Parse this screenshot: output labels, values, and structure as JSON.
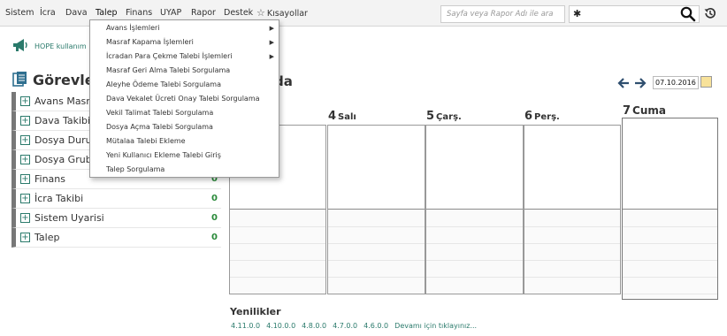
{
  "menubar": {
    "items": [
      "Sistem",
      "İcra",
      "Dava",
      "Talep",
      "Finans",
      "UYAP",
      "Rapor",
      "Destek"
    ],
    "favorites_label": "Kısayollar",
    "search_placeholder": "Sayfa veya Rapor Adı ile ara"
  },
  "dropdown": {
    "items": [
      {
        "label": "Avans İşlemleri",
        "submenu": true
      },
      {
        "label": "Masraf Kapama İşlemleri",
        "submenu": true
      },
      {
        "label": "İcradan Para Çekme Talebi İşlemleri",
        "submenu": true
      },
      {
        "label": "Masraf Geri Alma Talebi Sorgulama",
        "submenu": false
      },
      {
        "label": "Aleyhe Ödeme Talebi Sorgulama",
        "submenu": false
      },
      {
        "label": "Dava Vekalet Ücreti Onay Talebi Sorgulama",
        "submenu": false
      },
      {
        "label": "Vekil Talimat Talebi Sorgulama",
        "submenu": false
      },
      {
        "label": "Dosya Açma Talebi Sorgulama",
        "submenu": false
      },
      {
        "label": "Mütalaa Talebi Ekleme",
        "submenu": false
      },
      {
        "label": "Yeni Kullanıcı Ekleme Talebi Giriş",
        "submenu": false
      },
      {
        "label": "Talep Sorgulama",
        "submenu": false
      }
    ]
  },
  "announcement": "HOPE kullanım",
  "tasks": {
    "title": "Görevler",
    "items": [
      {
        "label": "Avans Masraf",
        "count": ""
      },
      {
        "label": "Dava Takibi",
        "count": ""
      },
      {
        "label": "Dosya Durum",
        "count": ""
      },
      {
        "label": "Dosya Grubu",
        "count": ""
      },
      {
        "label": "Finans",
        "count": "0"
      },
      {
        "label": "İcra Takibi",
        "count": "0"
      },
      {
        "label": "Sistem Uyarisi",
        "count": "0"
      },
      {
        "label": "Talep",
        "count": "0"
      }
    ]
  },
  "calendar": {
    "title": "da",
    "date": "07.10.2016",
    "days": [
      {
        "num": "",
        "name": ""
      },
      {
        "num": "4",
        "name": "Salı"
      },
      {
        "num": "5",
        "name": "Çarş."
      },
      {
        "num": "6",
        "name": "Perş."
      },
      {
        "num": "7",
        "name": "Cuma"
      }
    ]
  },
  "news": {
    "title": "Yenilikler",
    "versions": [
      "4.11.0.0",
      "4.10.0.0",
      "4.8.0.0",
      "4.7.0.0",
      "4.6.0.0"
    ],
    "more": "Devamı için tıklayınız..."
  },
  "colors": {
    "accent": "#2a7a6b",
    "count": "#2a8a3a"
  }
}
